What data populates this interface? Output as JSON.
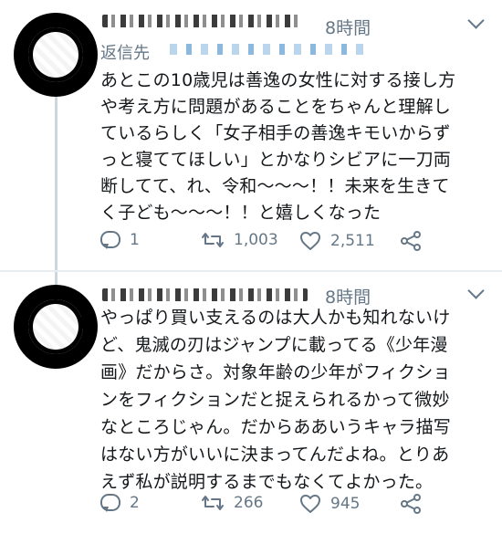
{
  "tweets": [
    {
      "time": "8時間",
      "reply_label": "返信先",
      "text": "あとこの10歳児は善逸の女性に対する接し方\nや考え方に問題があることをちゃんと理解し\nているらしく「女子相手の善逸キモいからず\nっと寝ててほしい」とかなりシビアに一刀両\n断してて、れ、令和〜〜〜！！未来を生きて\nく子ども〜〜〜！！と嬉しくなった",
      "replies": "1",
      "retweets": "1,003",
      "likes": "2,511"
    },
    {
      "time": "8時間",
      "text": "やっぱり買い支えるのは大人かも知れないけ\nど、鬼滅の刃はジャンプに載ってる《少年漫\n画》だからさ。対象年齢の少年がフィクショ\nンをフィクションだと捉えられるかって微妙\nなところじゃん。だからああいうキャラ描写\nはない方がいいに決まってんだよね。とりあ\nえず私が説明するまでもなくてよかった。",
      "replies": "2",
      "retweets": "266",
      "likes": "945"
    }
  ],
  "icons": [
    "reply-icon",
    "retweet-icon",
    "like-icon",
    "share-icon",
    "chevron-down-icon"
  ],
  "colors": {
    "secondary_text": "#657786",
    "body_text": "#14171a",
    "divider": "#e6ecf0"
  }
}
